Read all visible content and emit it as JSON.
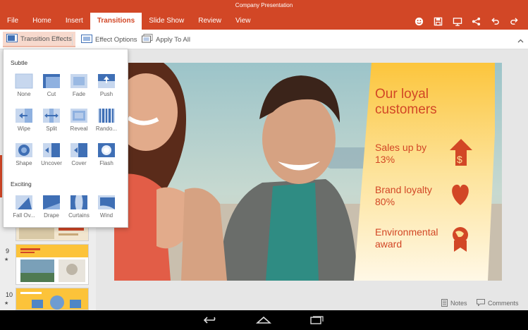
{
  "app": {
    "title": "Company Presentation"
  },
  "tabs": [
    "File",
    "Home",
    "Insert",
    "Transitions",
    "Slide Show",
    "Review",
    "View"
  ],
  "top_icons": [
    "smiley-icon",
    "save-icon",
    "present-icon",
    "share-icon",
    "undo-icon",
    "redo-icon"
  ],
  "ribbon": {
    "transition_effects": "Transition Effects",
    "effect_options": "Effect Options",
    "apply_to_all": "Apply To All"
  },
  "panel": {
    "subtle_label": "Subtle",
    "exciting_label": "Exciting",
    "subtle": [
      "None",
      "Cut",
      "Fade",
      "Push",
      "Wipe",
      "Split",
      "Reveal",
      "Rando...",
      "Shape",
      "Uncover",
      "Cover",
      "Flash"
    ],
    "exciting": [
      "Fall Ov...",
      "Drape",
      "Curtains",
      "Wind"
    ]
  },
  "thumbnails": [
    {
      "number": "9",
      "star": "★"
    },
    {
      "number": "10",
      "star": "★"
    }
  ],
  "slide": {
    "title_line1": "Our loyal",
    "title_line2": "customers",
    "item1_line1": "Sales up by",
    "item1_line2": "13%",
    "item2_line1": "Brand loyalty",
    "item2_line2": "80%",
    "item3_line1": "Environmental",
    "item3_line2": "award"
  },
  "status": {
    "notes": "Notes",
    "comments": "Comments"
  },
  "colors": {
    "accent": "#d24726",
    "card": "#fcc33a",
    "ribbon_active": "#f7d9cd"
  }
}
